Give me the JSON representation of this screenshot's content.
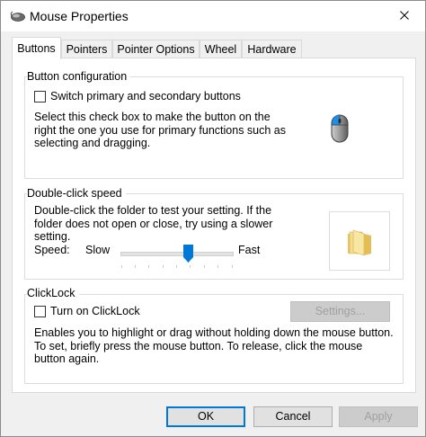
{
  "window": {
    "title": "Mouse Properties",
    "close_glyph": "×"
  },
  "tabs": [
    {
      "label": "Buttons",
      "active": true
    },
    {
      "label": "Pointers",
      "active": false
    },
    {
      "label": "Pointer Options",
      "active": false
    },
    {
      "label": "Wheel",
      "active": false
    },
    {
      "label": "Hardware",
      "active": false
    }
  ],
  "button_config": {
    "legend": "Button configuration",
    "checkbox_label": "Switch primary and secondary buttons",
    "checked": false,
    "description": "Select this check box to make the button on the right the one you use for primary functions such as selecting and dragging.",
    "description_lines": [
      "Select this check box to make the button on the",
      "right the one you use for primary functions such as",
      "selecting and dragging."
    ],
    "icon": "mouse-icon"
  },
  "double_click": {
    "legend": "Double-click speed",
    "description_lines": [
      "Double-click the folder to test your setting. If the",
      "folder does not open or close, try using a slower",
      "setting."
    ],
    "speed_label": "Speed:",
    "slow_label": "Slow",
    "fast_label": "Fast",
    "slider_value_fraction": 0.6,
    "icon": "folder-icon"
  },
  "clicklock": {
    "legend": "ClickLock",
    "checkbox_label": "Turn on ClickLock",
    "checked": false,
    "settings_button": "Settings...",
    "description_lines": [
      "Enables you to highlight or drag without holding down the mouse button.",
      "To set, briefly press the mouse button. To release, click the mouse",
      "button again."
    ]
  },
  "footer": {
    "ok": "OK",
    "cancel": "Cancel",
    "apply": "Apply"
  },
  "colors": {
    "accent": "#0078d7",
    "window_bg": "#f0f0f0",
    "panel_bg": "#ffffff",
    "disabled_text": "#a0a0a0"
  }
}
